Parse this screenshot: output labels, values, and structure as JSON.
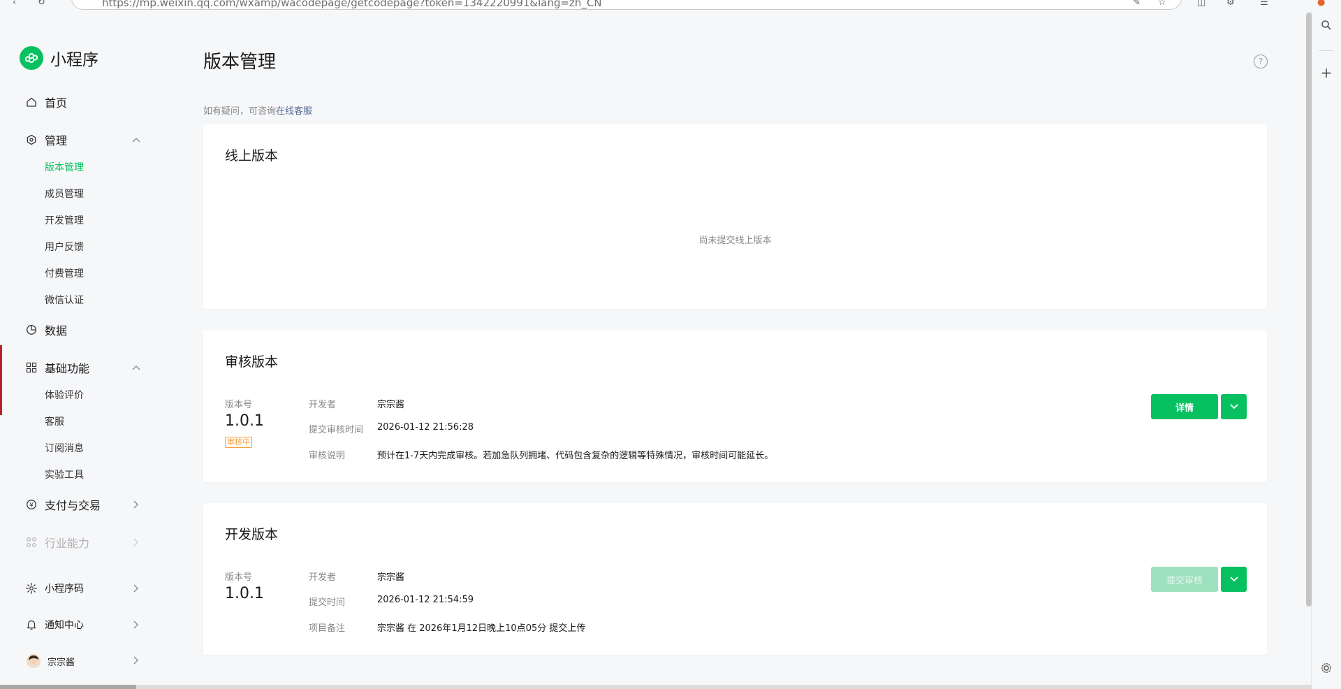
{
  "browser": {
    "url": "https://mp.weixin.qq.com/wxamp/wacodepage/getcodepage?token=1342220991&lang=zh_CN"
  },
  "sidebar": {
    "brand": "小程序",
    "home": "首页",
    "manage": {
      "label": "管理",
      "items": [
        "版本管理",
        "成员管理",
        "开发管理",
        "用户反馈",
        "付费管理",
        "微信认证"
      ]
    },
    "data": "数据",
    "basic": {
      "label": "基础功能",
      "items": [
        "体验评价",
        "客服",
        "订阅消息",
        "实验工具"
      ]
    },
    "pay": "支付与交易",
    "industry": "行业能力",
    "qrcode": "小程序码",
    "notify": "通知中心",
    "user": "宗宗酱"
  },
  "main": {
    "title": "版本管理",
    "hint_prefix": "如有疑问，可咨询",
    "hint_link": "在线客服",
    "online": {
      "title": "线上版本",
      "empty": "尚未提交线上版本"
    },
    "review": {
      "title": "审核版本",
      "version_label": "版本号",
      "version": "1.0.1",
      "status": "审核中",
      "fields": [
        {
          "label": "开发者",
          "value": "宗宗酱"
        },
        {
          "label": "提交审核时间",
          "value": "2026-01-12 21:56:28"
        },
        {
          "label": "审核说明",
          "value": "预计在1-7天内完成审核。若加急队列拥堵、代码包含复杂的逻辑等特殊情况，审核时间可能延长。"
        }
      ],
      "button": "详情"
    },
    "dev": {
      "title": "开发版本",
      "version_label": "版本号",
      "version": "1.0.1",
      "fields": [
        {
          "label": "开发者",
          "value": "宗宗酱"
        },
        {
          "label": "提交时间",
          "value": "2026-01-12 21:54:59"
        },
        {
          "label": "项目备注",
          "value": "宗宗酱 在 2026年1月12日晚上10点05分 提交上传"
        }
      ],
      "button": "提交审核"
    }
  },
  "colors": {
    "accent": "#07c160",
    "warning": "#fa9d3b",
    "link": "#576b95"
  }
}
